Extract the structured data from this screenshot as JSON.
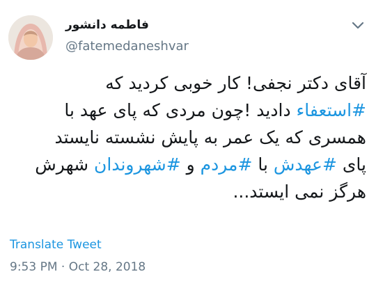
{
  "author": {
    "name": "فاطمه دانشور",
    "handle": "@fatemedaneshvar"
  },
  "tweet": {
    "lines": [
      [
        {
          "text": "آقای دکتر نجفی! کار خوبی کردید که"
        }
      ],
      [
        {
          "text": "#استعفاء",
          "hashtag": true
        },
        {
          "text": " دادید !چون مردی که پای عهد با"
        }
      ],
      [
        {
          "text": "همسری که یک عمر به پایش نشسته نایستد"
        }
      ],
      [
        {
          "text": "پای "
        },
        {
          "text": "#عهدش",
          "hashtag": true
        },
        {
          "text": " با "
        },
        {
          "text": "#مردم",
          "hashtag": true
        },
        {
          "text": " و  "
        },
        {
          "text": "#شهروندان",
          "hashtag": true
        },
        {
          "text": " شهرش"
        }
      ],
      [
        {
          "text": "هرگز نمی ایستد..."
        }
      ]
    ]
  },
  "actions": {
    "translate_label": "Translate Tweet"
  },
  "meta": {
    "time": "9:53 PM",
    "separator": " · ",
    "date": "Oct 28, 2018"
  },
  "icons": {
    "menu": "chevron-down-icon",
    "avatar": "profile-photo"
  },
  "colors": {
    "link": "#1b95e0",
    "secondary": "#657786",
    "text": "#14171a"
  }
}
